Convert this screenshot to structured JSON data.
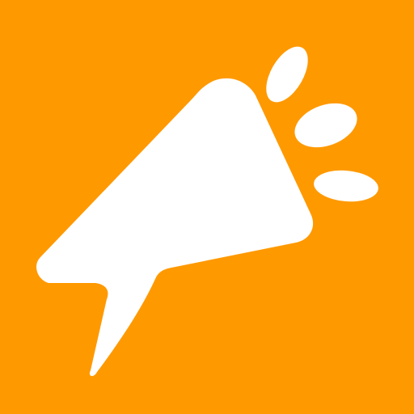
{
  "icon": {
    "name": "megaphone-speech-bubble-icon",
    "background_color": "#FF9900",
    "foreground_color": "#FFFFFF"
  }
}
